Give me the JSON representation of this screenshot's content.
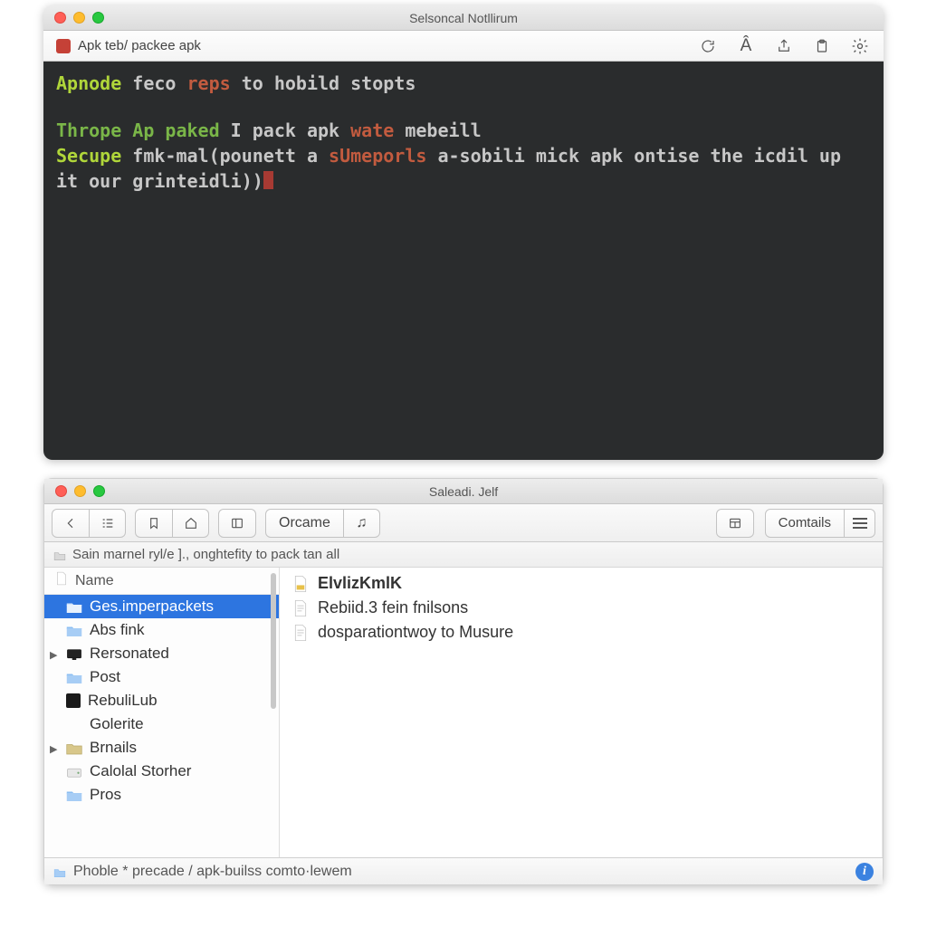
{
  "terminal": {
    "title": "Selsoncal Notllirum",
    "tab_label": "Apk teb/ packee apk",
    "lines": {
      "l1a": "Apnode",
      "l1b": " feco ",
      "l1c": "reps",
      "l1d": " to hobild stopts",
      "l2a": "Thrope Ap paked",
      "l2b": " I pack apk ",
      "l2c": "wate",
      "l2d": " mebeill",
      "l3a": "Secupe",
      "l3b": " fmk-mal",
      "l3c": "(pounett a ",
      "l3d": "sUmeporls",
      "l3e": " a-sobili ",
      "l3f": "mick",
      "l3g": " apk ontise the icdil up",
      "l4a": "it our grinteidli))"
    }
  },
  "finder": {
    "title": "Saleadi. Jelf",
    "orcame_label": "Orcame",
    "contails_label": "Comtails",
    "breadcrumb": "Sain marnel ryl/e ]., onghtefity to pack tan all",
    "sidebar_header": "Name",
    "sidebar_items": [
      {
        "label": "Ges.imperpackets",
        "type": "folder",
        "selected": true
      },
      {
        "label": "Abs fink",
        "type": "folder"
      },
      {
        "label": "Rersonated",
        "type": "monitor",
        "expandable": true
      },
      {
        "label": "Post",
        "type": "folder"
      },
      {
        "label": "RebuliLub",
        "type": "black"
      },
      {
        "label": "Golerite",
        "type": "none"
      },
      {
        "label": "Brnails",
        "type": "gold",
        "expandable": true
      },
      {
        "label": "Calolal Storher",
        "type": "disk"
      },
      {
        "label": "Pros",
        "type": "folder"
      }
    ],
    "files": [
      {
        "label": "ElvlizKmlK",
        "bold": true,
        "icon": "json"
      },
      {
        "label": "Rebiid.3 fein fnilsons",
        "icon": "doc"
      },
      {
        "label": "dosparationtwoy to Musure",
        "icon": "doc"
      }
    ],
    "status_path": "Phoble * precade / apk-builss comto·lewem"
  }
}
